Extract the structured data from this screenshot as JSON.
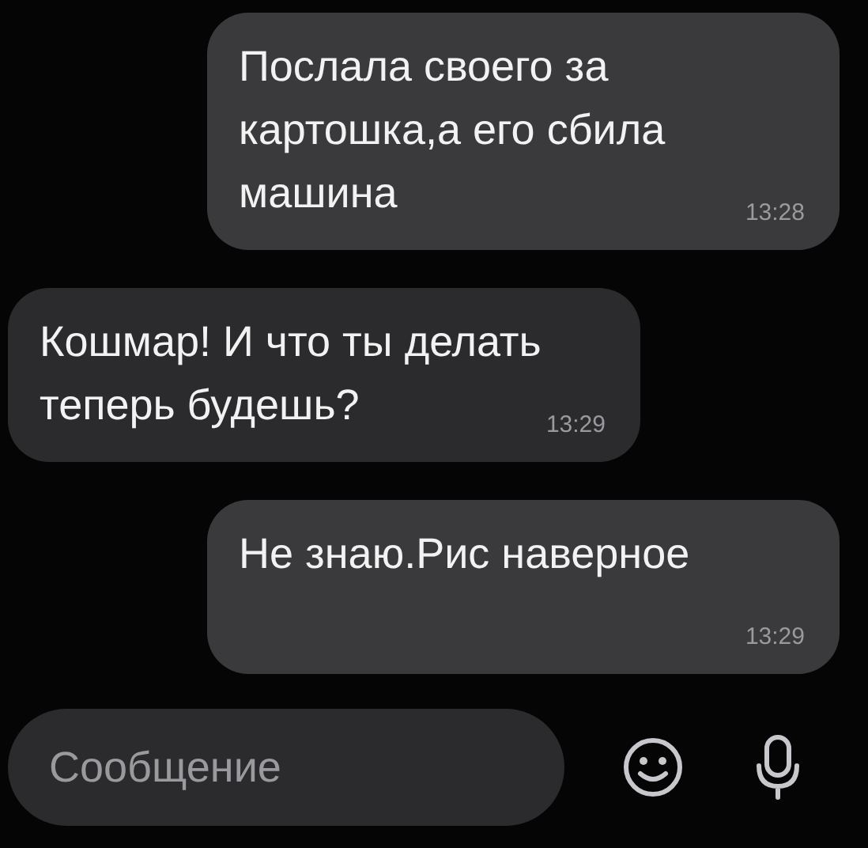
{
  "messages": [
    {
      "text": "Послала своего за картошка,а его сбила машина",
      "time": "13:28",
      "outgoing": true
    },
    {
      "text": "Кошмар! И что ты делать теперь будешь?",
      "time": "13:29",
      "outgoing": false
    },
    {
      "text": "Не знаю.Рис наверное",
      "time": "13:29",
      "outgoing": true
    }
  ],
  "composer": {
    "placeholder": "Сообщение"
  }
}
